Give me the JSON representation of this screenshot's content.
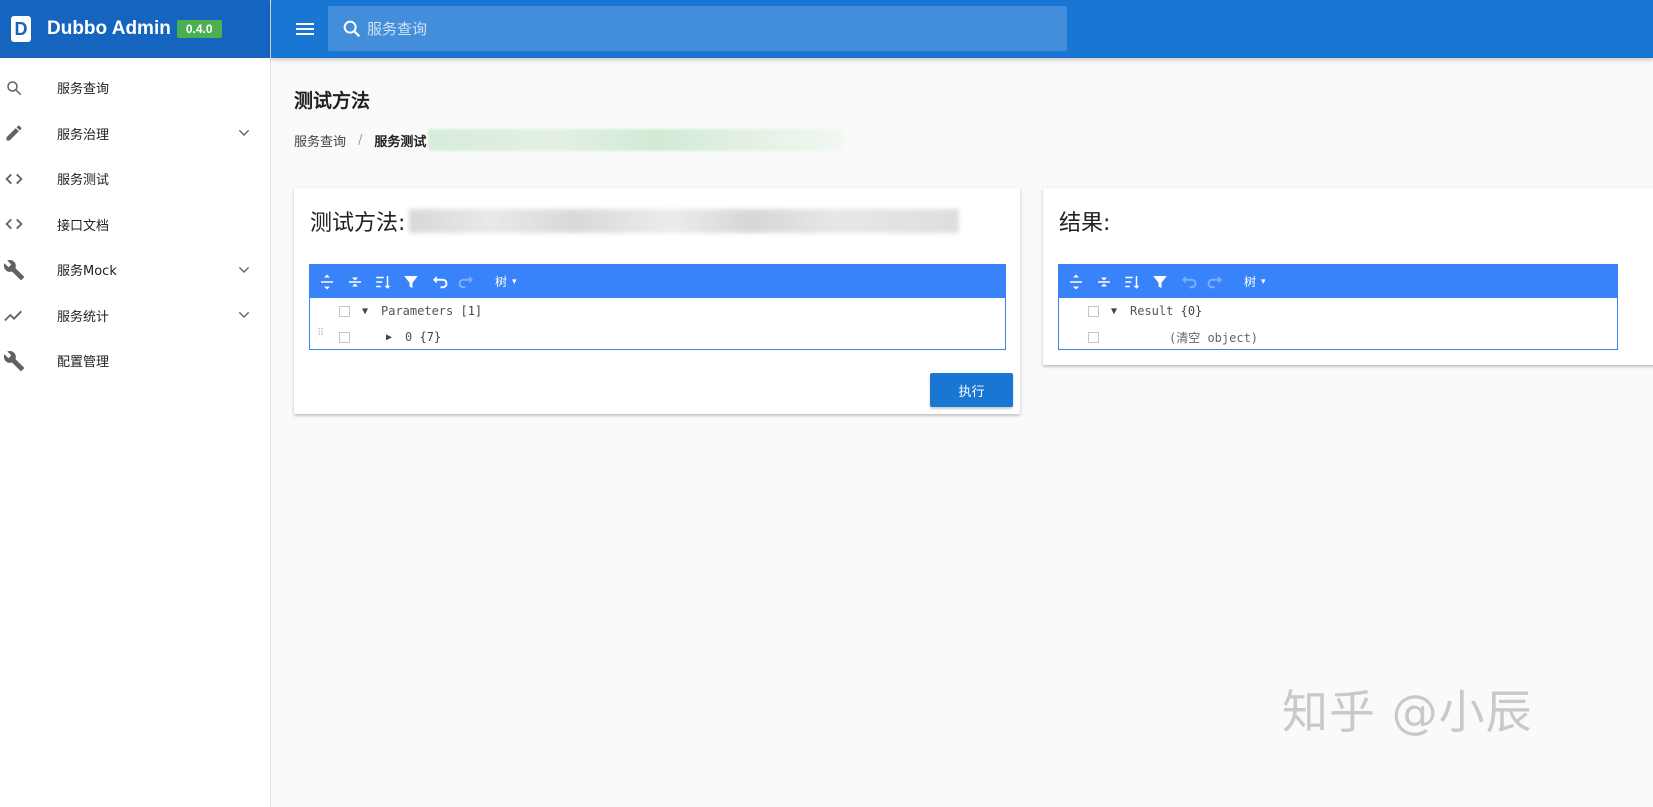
{
  "brand": {
    "title": "Dubbo Admin",
    "version": "0.4.0"
  },
  "search": {
    "placeholder": "服务查询"
  },
  "sidebar": {
    "items": [
      {
        "label": "服务查询",
        "icon": "search-icon",
        "expandable": false
      },
      {
        "label": "服务治理",
        "icon": "pencil-icon",
        "expandable": true
      },
      {
        "label": "服务测试",
        "icon": "code-icon",
        "expandable": false
      },
      {
        "label": "接口文档",
        "icon": "code-icon",
        "expandable": false
      },
      {
        "label": "服务Mock",
        "icon": "wrench-icon",
        "expandable": true
      },
      {
        "label": "服务统计",
        "icon": "trending-icon",
        "expandable": true
      },
      {
        "label": "配置管理",
        "icon": "wrench-icon",
        "expandable": false
      }
    ]
  },
  "page": {
    "title": "测试方法",
    "breadcrumb": [
      "服务查询",
      "服务测试"
    ]
  },
  "method_card": {
    "title": "测试方法:",
    "mode": "树",
    "tree": {
      "root_key": "Parameters",
      "root_count": "[1]",
      "child_key": "0",
      "child_count": "{7}"
    },
    "run_label": "执行"
  },
  "result_card": {
    "title": "结果:",
    "mode": "树",
    "tree": {
      "root_key": "Result",
      "root_count": "{0}",
      "empty_text": "(清空 object)"
    }
  },
  "watermark": "知乎 @小辰",
  "colors": {
    "sidebar_header": "#1565c0",
    "topbar": "#1976d2",
    "editor": "#3883fa",
    "badge": "#4caf50"
  }
}
